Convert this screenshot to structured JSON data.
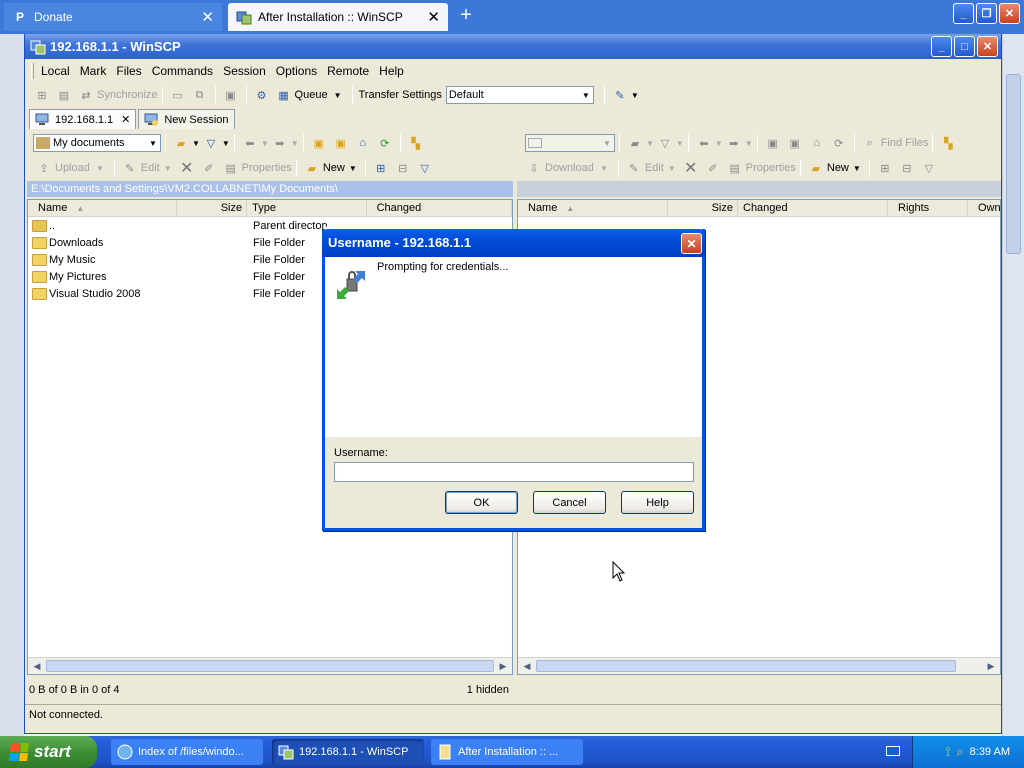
{
  "browser": {
    "tabs": [
      {
        "label": "Donate"
      },
      {
        "label": "After Installation :: WinSCP"
      }
    ]
  },
  "window": {
    "title": "192.168.1.1 - WinSCP"
  },
  "menu": [
    "Local",
    "Mark",
    "Files",
    "Commands",
    "Session",
    "Options",
    "Remote",
    "Help"
  ],
  "toolbar": {
    "synchronize": "Synchronize",
    "queue": "Queue",
    "transfer_settings_label": "Transfer Settings",
    "transfer_settings_value": "Default"
  },
  "session_tabs": [
    {
      "label": "192.168.1.1"
    },
    {
      "label": "New Session"
    }
  ],
  "left_panel": {
    "location": "My documents",
    "upload": "Upload",
    "edit": "Edit",
    "properties": "Properties",
    "new": "New",
    "path": "E:\\Documents and Settings\\VM2.COLLABNET\\My Documents\\",
    "columns": [
      "Name",
      "Size",
      "Type",
      "Changed"
    ],
    "rows": [
      {
        "name": "..",
        "type": "Parent directory"
      },
      {
        "name": "Downloads",
        "type": "File Folder"
      },
      {
        "name": "My Music",
        "type": "File Folder"
      },
      {
        "name": "My Pictures",
        "type": "File Folder"
      },
      {
        "name": "Visual Studio 2008",
        "type": "File Folder"
      }
    ],
    "summary": "0 B of 0 B in 0 of 4",
    "hidden": "1 hidden"
  },
  "right_panel": {
    "find_files": "Find Files",
    "download": "Download",
    "edit": "Edit",
    "properties": "Properties",
    "new": "New",
    "columns": [
      "Name",
      "Size",
      "Changed",
      "Rights",
      "Owner"
    ]
  },
  "status": "Not connected.",
  "dialog": {
    "title": "Username - 192.168.1.1",
    "message": "Prompting for credentials...",
    "username_label": "Username:",
    "username_value": "",
    "ok": "OK",
    "cancel": "Cancel",
    "help": "Help"
  },
  "taskbar": {
    "start": "start",
    "items": [
      {
        "label": "Index of /files/windo..."
      },
      {
        "label": "192.168.1.1 - WinSCP"
      },
      {
        "label": "After Installation :: ..."
      }
    ],
    "clock": "8:39 AM"
  },
  "colors": {
    "xp_blue": "#0054e3",
    "path_bar": "#a9c0e8",
    "start_green": "#3c8f33"
  }
}
